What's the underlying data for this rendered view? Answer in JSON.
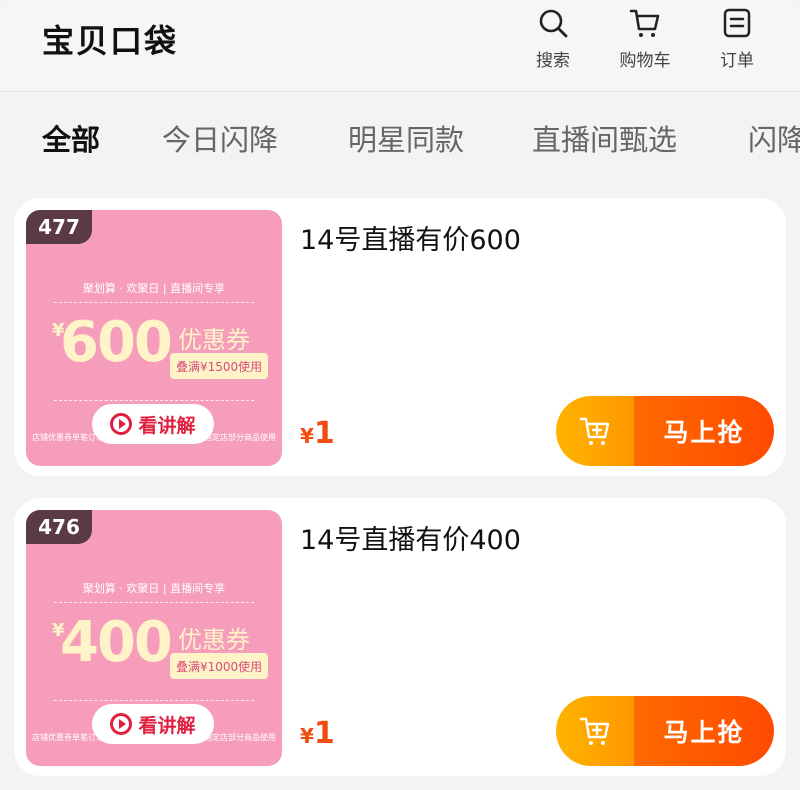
{
  "header": {
    "title": "宝贝口袋",
    "actions": [
      {
        "icon": "search-icon",
        "label": "搜索"
      },
      {
        "icon": "cart-icon",
        "label": "购物车"
      },
      {
        "icon": "order-icon",
        "label": "订单"
      }
    ]
  },
  "tabs": [
    {
      "label": "全部",
      "active": true
    },
    {
      "label": "今日闪降",
      "active": false
    },
    {
      "label": "明星同款",
      "active": false
    },
    {
      "label": "直播间甄选",
      "active": false
    },
    {
      "label": "闪降",
      "active": false
    }
  ],
  "products": [
    {
      "rank": "477",
      "promo_header": "聚划算 · 欢聚日 | 直播间专享",
      "yen": "¥",
      "amount": "600",
      "coupon_label": "优惠券",
      "coupon_condition": "叠满¥1500使用",
      "watch_label": "看讲解",
      "fine_print_left": "店铺优惠券单笔订单",
      "fine_print_right": "指定店部分商品使用",
      "title": "14号直播有价600",
      "price_symbol": "¥",
      "price": "1",
      "buy_label": "马上抢"
    },
    {
      "rank": "476",
      "promo_header": "聚划算 · 欢聚日 | 直播间专享",
      "yen": "¥",
      "amount": "400",
      "coupon_label": "优惠券",
      "coupon_condition": "叠满¥1000使用",
      "watch_label": "看讲解",
      "fine_print_left": "店铺优惠券单笔订单",
      "fine_print_right": "指定店部分商品使用",
      "title": "14号直播有价400",
      "price_symbol": "¥",
      "price": "1",
      "buy_label": "马上抢"
    }
  ],
  "colors": {
    "accent_orange": "#ff4a00",
    "accent_yellow": "#ffb400",
    "price_red": "#f04d12",
    "thumb_pink": "#f59dbb",
    "rank_badge": "#5a3a46"
  }
}
